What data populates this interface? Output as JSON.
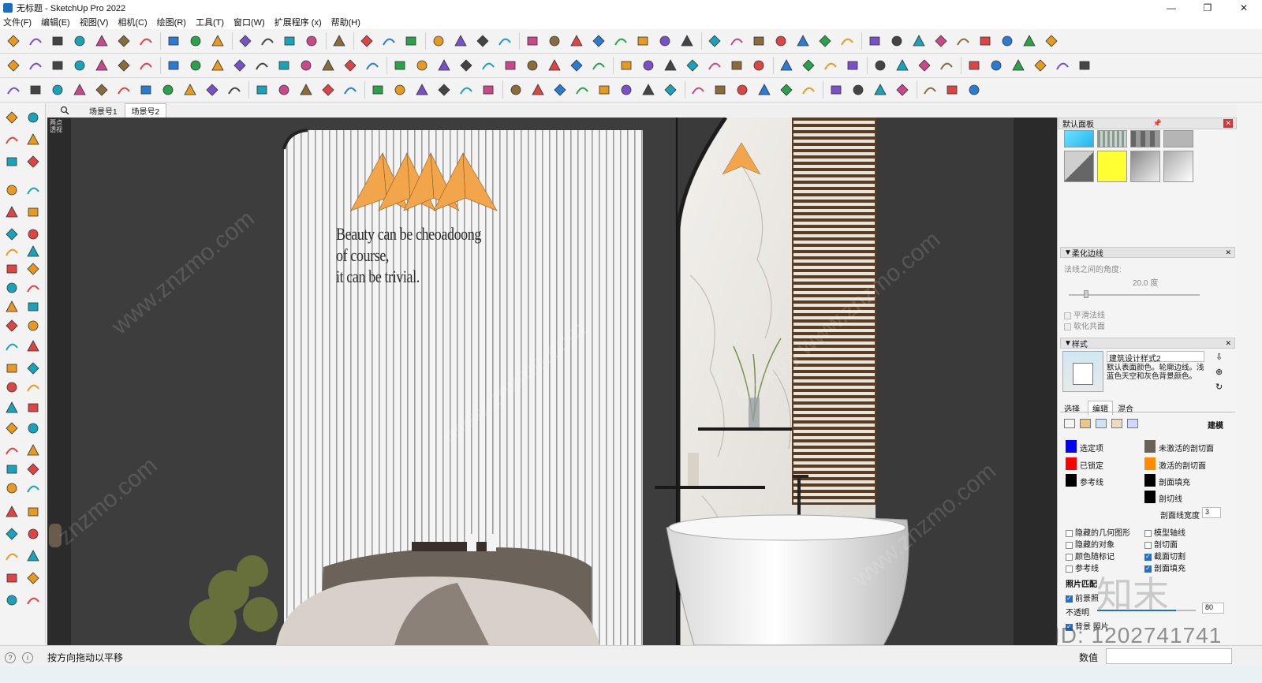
{
  "window": {
    "title": "无标题 - SketchUp Pro 2022",
    "minimize": "—",
    "maximize": "❐",
    "close": "✕"
  },
  "menu": [
    "文件(F)",
    "编辑(E)",
    "视图(V)",
    "相机(C)",
    "绘图(R)",
    "工具(T)",
    "窗口(W)",
    "扩展程序 (x)",
    "帮助(H)"
  ],
  "scene_tabs": {
    "search_icon": "search-icon",
    "tabs": [
      "场景号1",
      "场景号2"
    ],
    "active": 1
  },
  "viewport": {
    "camera_label": "两点透视",
    "wall_text": [
      "Beauty can be cheoadoong",
      "of course,",
      "it can be trivial."
    ],
    "watermarks": [
      "www.znzmo.com",
      "znzmo.com",
      "www.znzmo.com",
      "知末网 www.znzmo.com",
      "www.znzmo.com"
    ]
  },
  "right_panel": {
    "default_tray": "默认面板",
    "soften": {
      "title": "柔化边线",
      "angle_label": "法线之间的角度:",
      "angle_value": "20.0 度",
      "smooth_normals": "平滑法线",
      "soften_coplanar": "软化共面"
    },
    "styles": {
      "title": "样式",
      "style_name": "建筑设计样式2",
      "style_desc": "默认表面颜色。轮廓边线。浅蓝色天空和灰色背景颜色。",
      "tabs": [
        "选择",
        "编辑",
        "混合"
      ],
      "active_tab": 1,
      "modeling_label": "建模",
      "colors_left": [
        {
          "label": "选定项",
          "color": "#0000ff"
        },
        {
          "label": "已锁定",
          "color": "#ff0000"
        },
        {
          "label": "参考线",
          "color": "#000000"
        }
      ],
      "colors_right": [
        {
          "label": "未激活的剖切面",
          "color": "#6b6257"
        },
        {
          "label": "激活的剖切面",
          "color": "#ff8c00"
        },
        {
          "label": "剖面填充",
          "color": "#000000"
        },
        {
          "label": "剖切线",
          "color": "#000000"
        }
      ],
      "section_line_width_label": "剖面线宽度",
      "section_line_width_value": "3",
      "checks_left": [
        {
          "label": "隐藏的几何图形",
          "checked": false
        },
        {
          "label": "隐藏的对象",
          "checked": false
        },
        {
          "label": "颜色随标记",
          "checked": false
        },
        {
          "label": "参考线",
          "checked": false
        }
      ],
      "checks_right": [
        {
          "label": "模型轴线",
          "checked": false
        },
        {
          "label": "剖切面",
          "checked": false
        },
        {
          "label": "截面切割",
          "checked": true
        },
        {
          "label": "剖面填充",
          "checked": true
        }
      ],
      "photo_match_label": "照片匹配",
      "foreground_label": "前景照",
      "opacity_label": "不透明",
      "opacity_value": "80",
      "opacity_level": 0.8,
      "background_photo_label": "背景 照片"
    }
  },
  "status": {
    "hint": "按方向拖动以平移",
    "measure_label": "数值",
    "icons": [
      "help-circle-icon",
      "info-icon"
    ]
  },
  "overlay": {
    "id_watermark": "ID: 1202741741",
    "zm_logo": "知末"
  },
  "colors": {
    "accent": "#1f6fd1",
    "wall": "#3b3b3b",
    "lamp": "#f2a54a"
  }
}
